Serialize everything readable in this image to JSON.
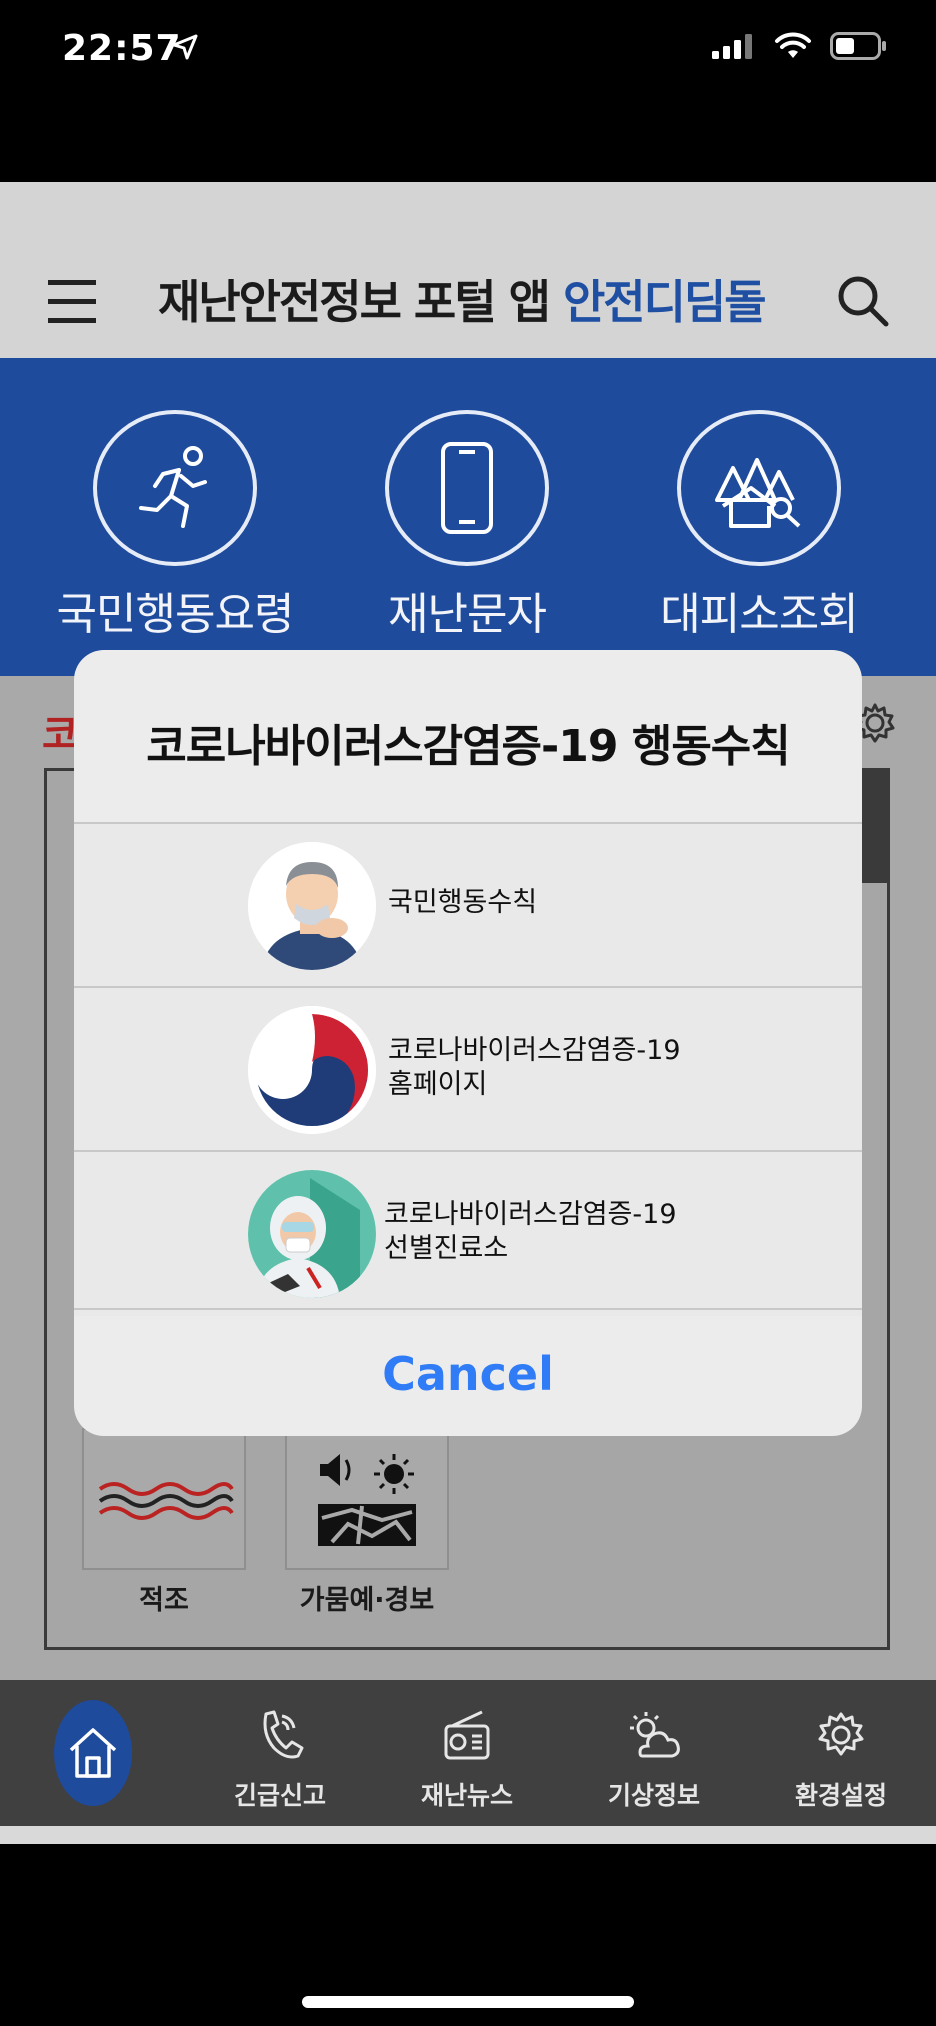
{
  "status": {
    "time": "22:57"
  },
  "header": {
    "title_main": "재난안전정보 포털 앱 ",
    "title_accent": "안전디딤돌"
  },
  "quick": {
    "items": [
      {
        "label": "국민행동요령"
      },
      {
        "label": "재난문자"
      },
      {
        "label": "대피소조회"
      }
    ]
  },
  "content": {
    "red_tag": "코",
    "tiles": [
      {
        "label": "적조"
      },
      {
        "label": "가뭄예·경보"
      }
    ]
  },
  "tabs": [
    {
      "label": ""
    },
    {
      "label": "긴급신고"
    },
    {
      "label": "재난뉴스"
    },
    {
      "label": "기상정보"
    },
    {
      "label": "환경설정"
    }
  ],
  "sheet": {
    "title": "코로나바이러스감염증-19 행동수칙",
    "rows": [
      {
        "line1": "국민행동수칙",
        "line2": ""
      },
      {
        "line1": "코로나바이러스감염증-19",
        "line2": "홈페이지"
      },
      {
        "line1": "코로나바이러스감염증-19",
        "line2": "선별진료소"
      }
    ],
    "cancel": "Cancel"
  },
  "colors": {
    "brand_blue": "#1f4b9c",
    "accent_blue": "#2f7cf6",
    "title_accent": "#1f4fa3"
  }
}
